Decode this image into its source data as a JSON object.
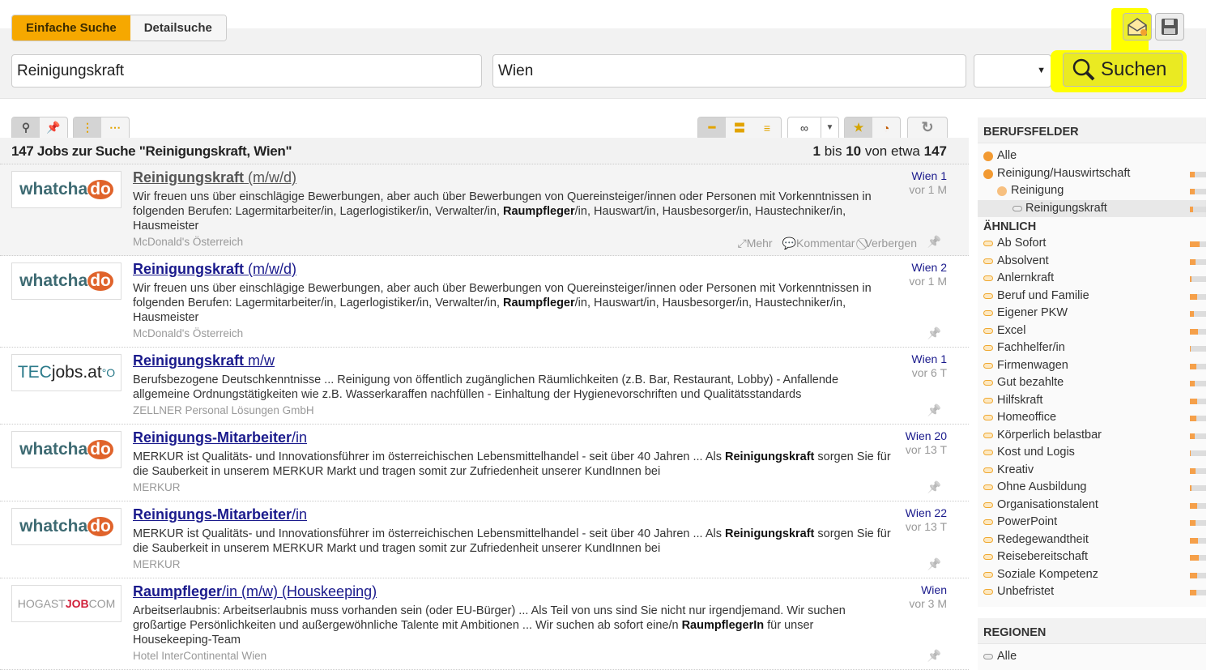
{
  "search": {
    "tabs": [
      {
        "label": "Einfache Suche",
        "active": true
      },
      {
        "label": "Detailsuche",
        "active": false
      }
    ],
    "what": "Reinigungskraft",
    "where": "Wien",
    "radius": "",
    "button": "Suchen",
    "icons": [
      "email-alert-icon",
      "save-icon"
    ],
    "highlight_color": "#ffff00"
  },
  "toolbar": {
    "limit": "∞"
  },
  "results": {
    "title": "147 Jobs zur Suche \"Reinigungskraft, Wien\"",
    "from": "1",
    "to": "10",
    "total": "147",
    "bis": "bis",
    "von": "von etwa"
  },
  "actions": {
    "more": "Mehr",
    "comment": "Kommentar",
    "hide": "Verbergen"
  },
  "jobs": [
    {
      "logo": "whatchado",
      "title_bold": "Reinigungskraft",
      "title_rest": " (m/w/d)",
      "desc": [
        {
          "t": "Wir freuen uns über einschlägige Bewerbungen, aber auch über Bewerbungen von Quereinsteiger/innen oder Personen mit Vorkenntnissen in folgenden Berufen: Lagermitarbeiter/in, Lagerlogistiker/in, Verwalter/in, "
        },
        {
          "t": "Raumpfleger",
          "b": true
        },
        {
          "t": "/in, Hauswart/in, Hausbesorger/in, Haustechniker/in, Hausmeister"
        }
      ],
      "company": "McDonald's Österreich",
      "location": "Wien 1",
      "age": "vor 1 M",
      "visited": true
    },
    {
      "logo": "whatchado",
      "title_bold": "Reinigungskraft",
      "title_rest": " (m/w/d)",
      "desc": [
        {
          "t": "Wir freuen uns über einschlägige Bewerbungen, aber auch über Bewerbungen von Quereinsteiger/innen oder Personen mit Vorkenntnissen in folgenden Berufen: Lagermitarbeiter/in, Lagerlogistiker/in, Verwalter/in, "
        },
        {
          "t": "Raumpfleger",
          "b": true
        },
        {
          "t": "/in, Hauswart/in, Hausbesorger/in, Haustechniker/in, Hausmeister"
        }
      ],
      "company": "McDonald's Österreich",
      "location": "Wien 2",
      "age": "vor 1 M"
    },
    {
      "logo": "TECjobs.at",
      "title_bold": "Reinigungskraft",
      "title_rest": " m/w",
      "desc": [
        {
          "t": "Berufsbezogene Deutschkenntnisse ... Reinigung von öffentlich zugänglichen Räumlichkeiten (z.B. Bar, Restaurant, Lobby) - Anfallende allgemeine Ordnungstätigkeiten wie z.B. Wasserkaraffen nachfüllen - Einhaltung der Hygienevorschriften und Qualitätsstandards"
        }
      ],
      "company": "ZELLNER Personal Lösungen GmbH",
      "location": "Wien 1",
      "age": "vor 6 T"
    },
    {
      "logo": "whatchado",
      "title_bold": "Reinigungs-Mitarbeiter",
      "title_rest": "/in",
      "desc": [
        {
          "t": "MERKUR ist Qualitäts- und Innovationsführer im österreichischen Lebensmittelhandel - seit über 40 Jahren ... Als "
        },
        {
          "t": "Reinigungskraft",
          "b": true
        },
        {
          "t": " sorgen Sie für die Sauberkeit in unserem MERKUR Markt und tragen somit zur Zufriedenheit unserer KundInnen bei"
        }
      ],
      "company": "MERKUR",
      "location": "Wien 20",
      "age": "vor 13 T"
    },
    {
      "logo": "whatchado",
      "title_bold": "Reinigungs-Mitarbeiter",
      "title_rest": "/in",
      "desc": [
        {
          "t": "MERKUR ist Qualitäts- und Innovationsführer im österreichischen Lebensmittelhandel - seit über 40 Jahren ... Als "
        },
        {
          "t": "Reinigungskraft",
          "b": true
        },
        {
          "t": " sorgen Sie für die Sauberkeit in unserem MERKUR Markt und tragen somit zur Zufriedenheit unserer KundInnen bei"
        }
      ],
      "company": "MERKUR",
      "location": "Wien 22",
      "age": "vor 13 T"
    },
    {
      "logo": "HOGASTJOB.COM",
      "title_bold": "Raumpfleger",
      "title_rest": "/in (m/w) (Houskeeping)",
      "desc": [
        {
          "t": "Arbeitserlaubnis: Arbeitserlaubnis muss vorhanden sein (oder EU-Bürger) ... Als Teil von uns sind Sie nicht nur irgendjemand. Wir suchen großartige Persönlichkeiten und außergewöhnliche Talente mit Ambitionen ... Wir suchen ab sofort eine/n "
        },
        {
          "t": "RaumpflegerIn",
          "b": true
        },
        {
          "t": " für unser Housekeeping-Team"
        }
      ],
      "company": "Hotel InterContinental Wien",
      "location": "Wien",
      "age": "vor 3 M"
    }
  ],
  "sidebar": {
    "berufsfelder_title": "BERUFSFELDER",
    "berufsfelder": [
      {
        "label": "Alle",
        "share": null
      },
      {
        "label": "Reinigung/Hauswirtschaft",
        "share": 0.3
      },
      {
        "label": "Reinigung",
        "share": 0.3
      },
      {
        "label": "Reinigungskraft",
        "share": 0.2,
        "selected": true
      }
    ],
    "aehnlich_title": "ÄHNLICH",
    "aehnlich": [
      {
        "label": "Ab Sofort",
        "share": 0.6
      },
      {
        "label": "Absolvent",
        "share": 0.35
      },
      {
        "label": "Anlernkraft",
        "share": 0.1
      },
      {
        "label": "Beruf und Familie",
        "share": 0.45
      },
      {
        "label": "Eigener PKW",
        "share": 0.25
      },
      {
        "label": "Excel",
        "share": 0.5
      },
      {
        "label": "Fachhelfer/in",
        "share": 0.05
      },
      {
        "label": "Firmenwagen",
        "share": 0.4
      },
      {
        "label": "Gut bezahlte",
        "share": 0.3
      },
      {
        "label": "Hilfskraft",
        "share": 0.45
      },
      {
        "label": "Homeoffice",
        "share": 0.4
      },
      {
        "label": "Körperlich belastbar",
        "share": 0.3
      },
      {
        "label": "Kost und Logis",
        "share": 0.03
      },
      {
        "label": "Kreativ",
        "share": 0.35
      },
      {
        "label": "Ohne Ausbildung",
        "share": 0.08
      },
      {
        "label": "Organisationstalent",
        "share": 0.45
      },
      {
        "label": "PowerPoint",
        "share": 0.35
      },
      {
        "label": "Redegewandtheit",
        "share": 0.5
      },
      {
        "label": "Reisebereitschaft",
        "share": 0.55
      },
      {
        "label": "Soziale Kompetenz",
        "share": 0.45
      },
      {
        "label": "Unbefristet",
        "share": 0.4
      }
    ],
    "regionen_title": "REGIONEN",
    "regionen": [
      {
        "label": "Alle"
      }
    ]
  }
}
